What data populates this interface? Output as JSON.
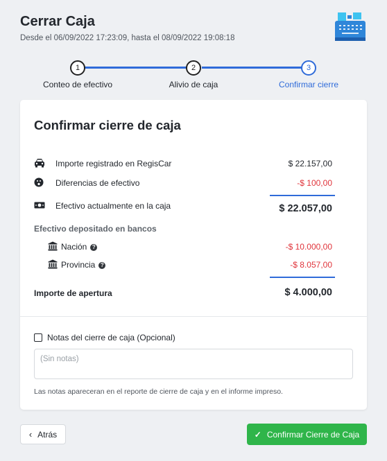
{
  "header": {
    "title": "Cerrar Caja",
    "subtitle": "Desde el 06/09/2022 17:23:09, hasta el 08/09/2022 19:08:18",
    "icon": "cash-register-icon"
  },
  "stepper": {
    "steps": [
      {
        "number": "1",
        "label": "Conteo de efectivo",
        "state": "done"
      },
      {
        "number": "2",
        "label": "Alivio de caja",
        "state": "done"
      },
      {
        "number": "3",
        "label": "Confirmar cierre",
        "state": "active"
      }
    ],
    "active_color": "#2f6bd9"
  },
  "card": {
    "title": "Confirmar cierre de caja",
    "rows": [
      {
        "icon": "car-icon",
        "label": "Importe registrado en RegisCar",
        "value": "$ 22.157,00"
      },
      {
        "icon": "surprised-face-icon",
        "label": "Diferencias de efectivo",
        "value": "-$ 100,00"
      },
      {
        "icon": "money-bill-icon",
        "label": "Efectivo actualmente en la caja",
        "value": "$ 22.057,00"
      }
    ],
    "deposits": {
      "heading": "Efectivo depositado en bancos",
      "banks": [
        {
          "icon": "bank-icon",
          "label": "Nación",
          "value": "-$ 10.000,00"
        },
        {
          "icon": "bank-icon",
          "label": "Provincia",
          "value": "-$ 8.057,00"
        }
      ]
    },
    "opening": {
      "label": "Importe de apertura",
      "value": "$ 4.000,00"
    }
  },
  "notes": {
    "label": "Notas del cierre de caja (Opcional)",
    "placeholder": "(Sin notas)",
    "help": "Las notas apareceran en el reporte de cierre de caja y en el informe impreso."
  },
  "actions": {
    "back_label": "Atrás",
    "confirm_label": "Confirmar Cierre de Caja"
  },
  "colors": {
    "accent": "#2f6bd9",
    "negative": "#e0343b",
    "confirm": "#2fb54a"
  }
}
